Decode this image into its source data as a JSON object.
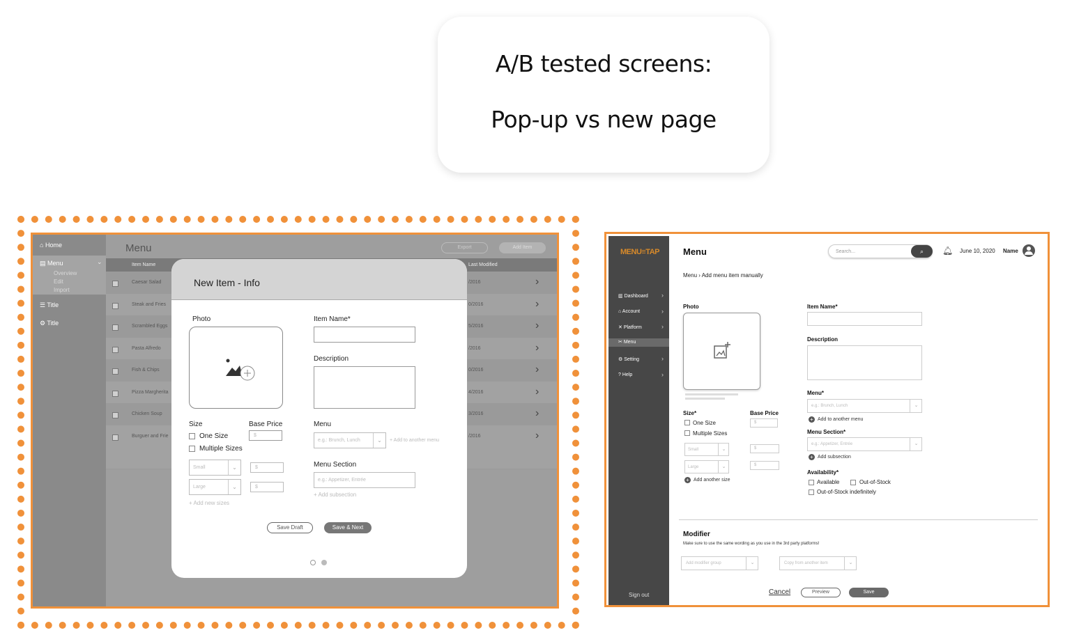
{
  "callout": {
    "line1": "A/B tested screens:",
    "line2": "Pop-up vs new page"
  },
  "left": {
    "sidebar": {
      "home": "Home",
      "menu": "Menu",
      "overview": "Overview",
      "edit": "Edit",
      "import": "Import",
      "title1": "Title",
      "title2": "Title"
    },
    "header": {
      "title": "Menu",
      "export": "Export",
      "add_item": "Add Item"
    },
    "table": {
      "col_name": "Item Name",
      "col_modified": "Last Modified",
      "rows": [
        {
          "name": "Caesar Salad",
          "date": "/2016"
        },
        {
          "name": "Steak and Fries",
          "date": "0/2016"
        },
        {
          "name": "Scrambled Eggs",
          "date": "5/2016"
        },
        {
          "name": "Pasta Alfredo",
          "date": "/2016"
        },
        {
          "name": "Fish & Chips",
          "date": "0/2016"
        },
        {
          "name": "Pizza Margherita",
          "date": "4/2016"
        },
        {
          "name": "Chicken Soup",
          "date": "3/2016"
        },
        {
          "name": "Burguer and Frie",
          "date": "/2016"
        }
      ]
    },
    "modal": {
      "title": "New Item - Info",
      "photo": "Photo",
      "item_name": "Item Name*",
      "description": "Description",
      "size": "Size",
      "base_price": "Base Price",
      "one_size": "One Size",
      "multiple_sizes": "Multiple Sizes",
      "price_ph": "$",
      "small_ph": "Small",
      "large_ph": "Large",
      "add_sizes": "+ Add new sizes",
      "menu": "Menu",
      "menu_ph": "e.g.: Brunch, Lunch",
      "add_menu": "+ Add to another menu",
      "menu_section": "Menu Section",
      "section_ph": "e.g.: Appetizer, Entrée",
      "add_subsection": "+ Add subsection",
      "save_draft": "Save Draft",
      "save_next": "Save & Next"
    }
  },
  "right": {
    "logo": "MENU≡TAP",
    "nav": [
      "Dashboard",
      "Account",
      "Platform",
      "Menu",
      "Setting",
      "Help"
    ],
    "signout": "Sign out",
    "title": "Menu",
    "search_ph": "Search...",
    "date": "June 10, 2020",
    "name": "Name",
    "breadcrumb_root": "Menu",
    "breadcrumb_current": "Add menu item manually",
    "photo": "Photo",
    "size": "Size*",
    "base_price": "Base Price",
    "one_size": "One Size",
    "multiple_sizes": "Multiple Sizes",
    "small_ph": "Small",
    "large_ph": "Large",
    "price_ph": "$",
    "add_size": "Add another size",
    "item_name": "Item Name*",
    "description": "Description",
    "menu": "Menu*",
    "menu_ph": "e.g.: Brunch, Lunch",
    "add_menu": "Add to another menu",
    "menu_section": "Menu Section*",
    "section_ph": "e.g.: Appetizer, Entrée",
    "add_subsection": "Add subsection",
    "availability": "Availability*",
    "available": "Available",
    "out_of_stock": "Out-of-Stock",
    "out_indef": "Out-of-Stock indefinitely",
    "modifier": "Modifier",
    "modifier_note": "Make sure to use the same wording as you use in the 3rd party platforms!",
    "add_modifier_ph": "Add modifier group",
    "copy_item_ph": "Copy from another item",
    "cancel": "Cancel",
    "preview": "Preview",
    "save": "Save"
  },
  "colors": {
    "accent": "#f0913a"
  }
}
